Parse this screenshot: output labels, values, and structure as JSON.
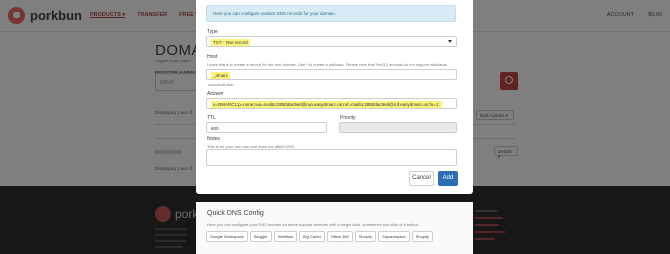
{
  "nav": {
    "logo": "porkbun",
    "items": [
      "PRODUCTS ▾",
      "TRANSFER",
      "FREE WORK"
    ],
    "account": "ACCOUNT",
    "cart": "$0.00"
  },
  "page": {
    "title": "DOMAI",
    "subtitle": "Logged in as: robert",
    "register_heading": "REGISTER A NEW DOMAIN",
    "search_value": "DRVK",
    "displaying_1": "Displaying 1 out of",
    "bulk_actions": "Bulk Actions ▾",
    "details": "Details ▾",
    "displaying_2": "Displaying 1 out of"
  },
  "footer": {
    "logo": "porkbun"
  },
  "modal": {
    "info": "Here you can configure custom DNS records for your domain.",
    "type_label": "Type",
    "type_value": "TXT - Text record",
    "host_label": "Host",
    "host_help": "Leave blank to create a record for the root domain. Use * to create a wildcard. Please note that %s010 records do not support wildcards.",
    "host_value": "_dmarc",
    "host_suffix": ".coscosoft.club",
    "answer_label": "Answer",
    "answer_value": "v=DMARC1;p=none;rua=mailto:2850dac9ed@rua.easydmarc.us;ruf=mailto:2850dac9ed@ruf.easydmarc.us;fo=1;",
    "ttl_label": "TTL",
    "ttl_value": "600",
    "priority_label": "Priority",
    "priority_value": "",
    "notes_label": "Notes",
    "notes_help": "This is for your own use and does not affect DNS.",
    "notes_value": "",
    "cancel_label": "Cancel",
    "add_label": "Add"
  },
  "quick_dns": {
    "title": "Quick DNS Config",
    "description": "Here you can configure your DNS records for some popular services with a single click, sometimes two click of a button.",
    "buttons": [
      "Google Workspace",
      "Blogger",
      "Webflow",
      "Big Cartel",
      "Office 365",
      "Shopify",
      "Squarespace",
      "Shopify"
    ]
  }
}
